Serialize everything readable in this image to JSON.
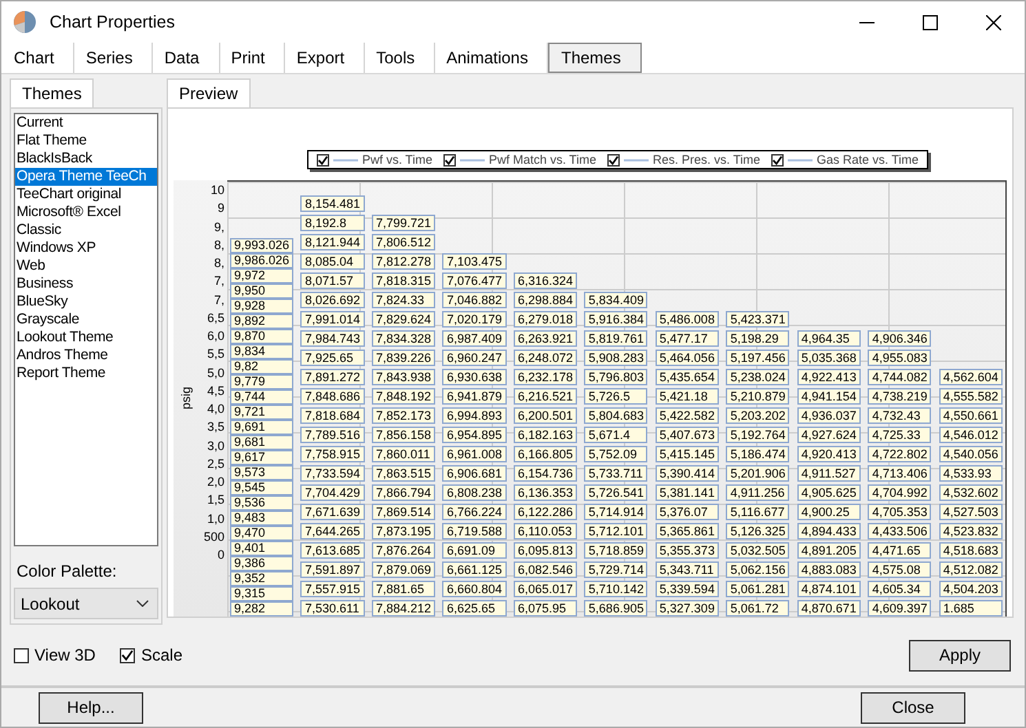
{
  "window": {
    "title": "Chart Properties"
  },
  "tabs": [
    {
      "label": "Chart",
      "selected": false
    },
    {
      "label": "Series",
      "selected": false
    },
    {
      "label": "Data",
      "selected": false
    },
    {
      "label": "Print",
      "selected": false
    },
    {
      "label": "Export",
      "selected": false
    },
    {
      "label": "Tools",
      "selected": false
    },
    {
      "label": "Animations",
      "selected": false
    },
    {
      "label": "Themes",
      "selected": true
    }
  ],
  "themes_panel": {
    "tab": {
      "label": "Themes",
      "selected": true
    },
    "items": [
      {
        "label": "Current",
        "selected": false
      },
      {
        "label": "Flat Theme",
        "selected": false
      },
      {
        "label": "BlackIsBack",
        "selected": false
      },
      {
        "label": "Opera Theme TeeCh",
        "selected": true
      },
      {
        "label": "TeeChart original",
        "selected": false
      },
      {
        "label": "Microsoft® Excel",
        "selected": false
      },
      {
        "label": "Classic",
        "selected": false
      },
      {
        "label": "Windows XP",
        "selected": false
      },
      {
        "label": "Web",
        "selected": false
      },
      {
        "label": "Business",
        "selected": false
      },
      {
        "label": "BlueSky",
        "selected": false
      },
      {
        "label": "Grayscale",
        "selected": false
      },
      {
        "label": "Lookout Theme",
        "selected": false
      },
      {
        "label": "Andros Theme",
        "selected": false
      },
      {
        "label": "Report Theme",
        "selected": false
      }
    ],
    "palette_label": "Color Palette:",
    "palette": {
      "value": "Lookout"
    }
  },
  "preview": {
    "tab": {
      "label": "Preview",
      "selected": true
    },
    "legend": [
      {
        "label": "Pwf vs. Time",
        "checked": true
      },
      {
        "label": "Pwf Match vs. Time",
        "checked": true
      },
      {
        "label": "Res. Pres. vs. Time",
        "checked": true
      },
      {
        "label": "Gas Rate vs. Time",
        "checked": true
      }
    ],
    "y_axis_label": "psig",
    "y_ticks": [
      "10",
      "9",
      "9,",
      "8,",
      "8,",
      "7,",
      "7,",
      "6,5",
      "6,0",
      "5,5",
      "5,0",
      "4,5",
      "4,0",
      "3,5",
      "3,0",
      "2,5",
      "2,0",
      "1,5",
      "1,0",
      "500",
      "0"
    ],
    "label_columns": [
      [
        "9,993.026",
        "9,986.026",
        "9,972",
        "9,950",
        "9,928",
        "9,892",
        "9,870",
        "9,834",
        "9,82",
        "9,779",
        "9,744",
        "9,721",
        "9,691",
        "9,681",
        "9,617",
        "9,573",
        "9,545",
        "9,536",
        "9,483",
        "9,470",
        "9,401",
        "9,386",
        "9,352",
        "9,315",
        "9,282"
      ],
      [
        "8,154.481",
        "8,192.8",
        "8,121.944",
        "8,085.04",
        "8,071.57",
        "8,026.692",
        "7,991.014",
        "7,984.743",
        "7,925.65",
        "7,891.272",
        "7,848.686",
        "7,818.684",
        "7,789.516",
        "7,758.915",
        "7,733.594",
        "7,704.429",
        "7,671.639",
        "7,644.265",
        "7,613.685",
        "7,591.897",
        "7,557.915",
        "7,530.611"
      ],
      [
        "7,799.721",
        "7,806.512",
        "7,812.278",
        "7,818.315",
        "7,824.33",
        "7,829.624",
        "7,834.328",
        "7,839.226",
        "7,843.938",
        "7,848.192",
        "7,852.173",
        "7,856.158",
        "7,860.011",
        "7,863.515",
        "7,866.794",
        "7,869.514",
        "7,873.195",
        "7,876.264",
        "7,879.069",
        "7,881.65",
        "7,884.212"
      ],
      [
        "7,103.475",
        "7,076.477",
        "7,046.882",
        "7,020.179",
        "6,987.409",
        "6,960.247",
        "6,930.638",
        "6,941.879",
        "6,994.893",
        "6,954.895",
        "6,961.008",
        "6,906.681",
        "6,808.238",
        "6,766.224",
        "6,719.588",
        "6,691.09",
        "6,661.125",
        "6,660.804",
        "6,625.65"
      ],
      [
        "6,316.324",
        "6,298.884",
        "6,279.018",
        "6,263.921",
        "6,248.072",
        "6,232.178",
        "6,216.521",
        "6,200.501",
        "6,182.163",
        "6,166.805",
        "6,154.736",
        "6,136.353",
        "6,122.286",
        "6,110.053",
        "6,095.813",
        "6,082.546",
        "6,065.017",
        "6,075.95"
      ],
      [
        "5,834.409",
        "5,916.384",
        "5,819.761",
        "5,908.283",
        "5,796.803",
        "5,726.5",
        "5,804.683",
        "5,671.4",
        "5,752.09",
        "5,733.711",
        "5,726.541",
        "5,714.914",
        "5,712.101",
        "5,718.859",
        "5,729.714",
        "5,710.142",
        "5,686.905"
      ],
      [
        "5,486.008",
        "5,477.17",
        "5,464.056",
        "5,435.654",
        "5,421.18",
        "5,422.582",
        "5,407.673",
        "5,415.145",
        "5,390.414",
        "5,381.141",
        "5,376.07",
        "5,365.861",
        "5,355.373",
        "5,343.711",
        "5,339.594",
        "5,327.309"
      ],
      [
        "5,423.371",
        "5,198.29",
        "5,197.456",
        "5,238.024",
        "5,210.879",
        "5,203.202",
        "5,192.764",
        "5,186.474",
        "5,201.906",
        "4,911.256",
        "5,116.677",
        "5,126.325",
        "5,032.505",
        "5,062.156",
        "5,061.281",
        "5,061.72"
      ],
      [
        "4,964.35",
        "5,035.368",
        "4,922.413",
        "4,941.154",
        "4,936.037",
        "4,927.624",
        "4,920.413",
        "4,911.527",
        "4,905.625",
        "4,900.25",
        "4,894.433",
        "4,891.205",
        "4,883.083",
        "4,874.101",
        "4,870.671"
      ],
      [
        "4,906.346",
        "4,955.083",
        "4,744.082",
        "4,738.219",
        "4,732.43",
        "4,725.33",
        "4,722.802",
        "4,713.406",
        "4,704.992",
        "4,705.353",
        "4,433.506",
        "4,471.65",
        "4,575.08",
        "4,605.34",
        "4,609.397"
      ],
      [
        "4,562.604",
        "4,555.582",
        "4,550.661",
        "4,546.012",
        "4,540.056",
        "4,533.93",
        "4,532.602",
        "4,527.503",
        "4,523.832",
        "4,518.683",
        "4,512.082",
        "4,504.203",
        "1.685"
      ]
    ]
  },
  "options": [
    {
      "label": "View 3D",
      "checked": false
    },
    {
      "label": "Scale",
      "checked": true
    }
  ],
  "apply_button": "Apply",
  "footer_buttons": [
    "Help...",
    "Close"
  ]
}
